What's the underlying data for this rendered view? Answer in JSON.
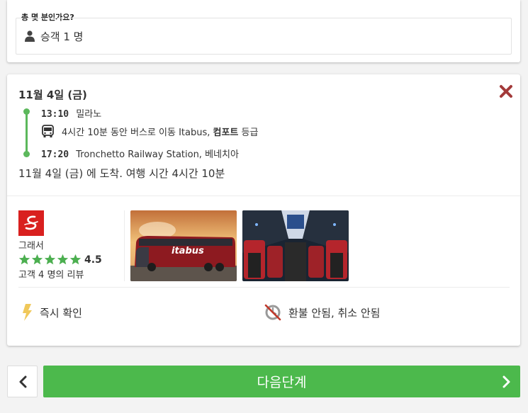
{
  "passengers": {
    "question": "총 몇 분인가요?",
    "value": "승객 1 명"
  },
  "trip": {
    "date": "11월 4일 (금)",
    "departure": {
      "time": "13:10",
      "place": "밀라노"
    },
    "transport": {
      "text_pre": "4시간 10분 동안 버스로 이동 Itabus, ",
      "class_bold": "컴포트",
      "text_post": " 등급"
    },
    "arrival_stop": {
      "time": "17:20",
      "place": "Tronchetto Railway Station, 베네치아"
    },
    "arrival_summary": "11월 4일 (금) 에 도착. 여행 시간 4시간 10분"
  },
  "operator": {
    "name": "그래서",
    "rating": "4.5",
    "stars": 5,
    "reviews": "고객 4 명의 리뷰",
    "photo_exterior_brand": "itabus"
  },
  "features": {
    "instant": "즉시 확인",
    "refund": "환불 안됨, 취소 안됨"
  },
  "nav": {
    "next_label": "다음단계"
  },
  "colors": {
    "accent_green": "#4cb94c",
    "timeline_green": "#5cb85c",
    "close_red": "#a33a3a",
    "star_green": "#4caf50",
    "brand_red": "#d9201f",
    "bolt_yellow": "#f0c85a"
  }
}
